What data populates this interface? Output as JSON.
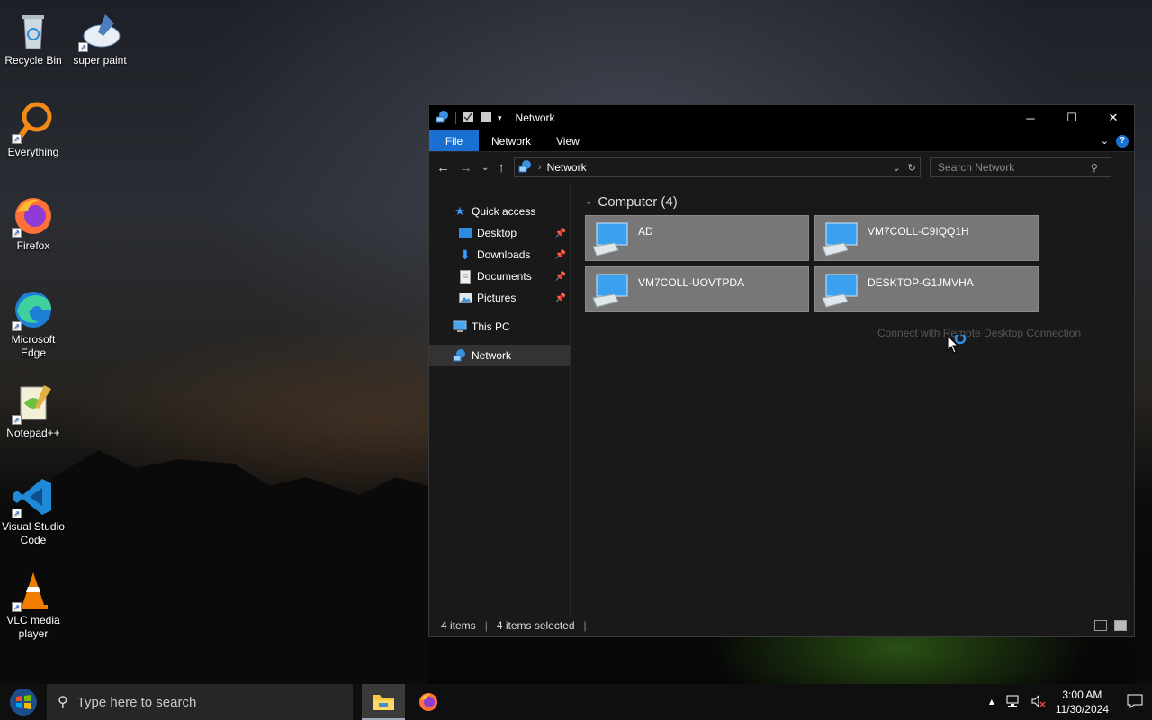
{
  "desktop": {
    "icons": [
      {
        "label": "Recycle Bin"
      },
      {
        "label": "super paint"
      },
      {
        "label": "Everything"
      },
      {
        "label": "Firefox"
      },
      {
        "label": "Microsoft Edge"
      },
      {
        "label": "Notepad++"
      },
      {
        "label": "Visual Studio Code"
      },
      {
        "label": "VLC media player"
      }
    ]
  },
  "window": {
    "title": "Network",
    "ribbon": {
      "file": "File",
      "network": "Network",
      "view": "View"
    },
    "address": {
      "crumb": "Network"
    },
    "search": {
      "placeholder": "Search Network"
    },
    "navpane": {
      "quick_access": "Quick access",
      "desktop": "Desktop",
      "downloads": "Downloads",
      "documents": "Documents",
      "pictures": "Pictures",
      "this_pc": "This PC",
      "network": "Network"
    },
    "group": {
      "label": "Computer (4)"
    },
    "computers": [
      "AD",
      "VM7COLL-C9IQQ1H",
      "VM7COLL-UOVTPDA",
      "DESKTOP-G1JMVHA"
    ],
    "tooltip": "Connect with Remote Desktop Connection",
    "status": {
      "items": "4 items",
      "selected": "4 items selected"
    }
  },
  "taskbar": {
    "search_placeholder": "Type here to search",
    "time": "3:00 AM",
    "date": "11/30/2024"
  },
  "colors": {
    "accent": "#1a6fd2",
    "tile_selected": "#777777"
  }
}
